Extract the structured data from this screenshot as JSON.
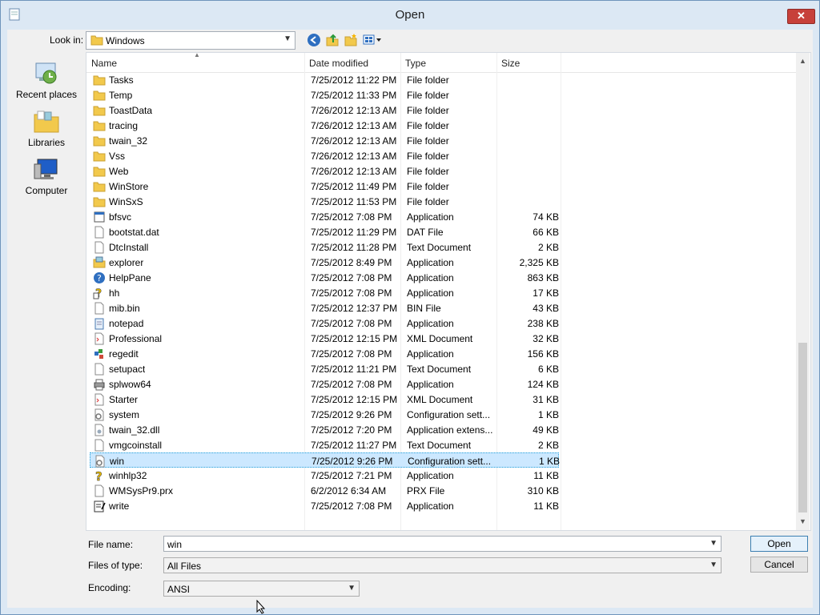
{
  "window": {
    "title": "Open",
    "close_glyph": "✕"
  },
  "toolbar": {
    "look_in_label": "Look in:",
    "look_in_value": "Windows"
  },
  "places": [
    {
      "label": "Recent places",
      "icon": "recent-places-icon"
    },
    {
      "label": "Libraries",
      "icon": "libraries-icon"
    },
    {
      "label": "Computer",
      "icon": "computer-icon"
    }
  ],
  "columns": {
    "name": "Name",
    "date": "Date modified",
    "type": "Type",
    "size": "Size"
  },
  "files": [
    {
      "name": "Tasks",
      "date": "7/25/2012 11:22 PM",
      "type": "File folder",
      "size": "",
      "icon": "folder"
    },
    {
      "name": "Temp",
      "date": "7/25/2012 11:33 PM",
      "type": "File folder",
      "size": "",
      "icon": "folder"
    },
    {
      "name": "ToastData",
      "date": "7/26/2012 12:13 AM",
      "type": "File folder",
      "size": "",
      "icon": "folder"
    },
    {
      "name": "tracing",
      "date": "7/26/2012 12:13 AM",
      "type": "File folder",
      "size": "",
      "icon": "folder"
    },
    {
      "name": "twain_32",
      "date": "7/26/2012 12:13 AM",
      "type": "File folder",
      "size": "",
      "icon": "folder"
    },
    {
      "name": "Vss",
      "date": "7/26/2012 12:13 AM",
      "type": "File folder",
      "size": "",
      "icon": "folder"
    },
    {
      "name": "Web",
      "date": "7/26/2012 12:13 AM",
      "type": "File folder",
      "size": "",
      "icon": "folder"
    },
    {
      "name": "WinStore",
      "date": "7/25/2012 11:49 PM",
      "type": "File folder",
      "size": "",
      "icon": "folder"
    },
    {
      "name": "WinSxS",
      "date": "7/25/2012 11:53 PM",
      "type": "File folder",
      "size": "",
      "icon": "folder"
    },
    {
      "name": "bfsvc",
      "date": "7/25/2012 7:08 PM",
      "type": "Application",
      "size": "74 KB",
      "icon": "app"
    },
    {
      "name": "bootstat.dat",
      "date": "7/25/2012 11:29 PM",
      "type": "DAT File",
      "size": "66 KB",
      "icon": "file"
    },
    {
      "name": "DtcInstall",
      "date": "7/25/2012 11:28 PM",
      "type": "Text Document",
      "size": "2 KB",
      "icon": "file"
    },
    {
      "name": "explorer",
      "date": "7/25/2012 8:49 PM",
      "type": "Application",
      "size": "2,325 KB",
      "icon": "explorer"
    },
    {
      "name": "HelpPane",
      "date": "7/25/2012 7:08 PM",
      "type": "Application",
      "size": "863 KB",
      "icon": "help"
    },
    {
      "name": "hh",
      "date": "7/25/2012 7:08 PM",
      "type": "Application",
      "size": "17 KB",
      "icon": "hh"
    },
    {
      "name": "mib.bin",
      "date": "7/25/2012 12:37 PM",
      "type": "BIN File",
      "size": "43 KB",
      "icon": "file"
    },
    {
      "name": "notepad",
      "date": "7/25/2012 7:08 PM",
      "type": "Application",
      "size": "238 KB",
      "icon": "notepad"
    },
    {
      "name": "Professional",
      "date": "7/25/2012 12:15 PM",
      "type": "XML Document",
      "size": "32 KB",
      "icon": "xml"
    },
    {
      "name": "regedit",
      "date": "7/25/2012 7:08 PM",
      "type": "Application",
      "size": "156 KB",
      "icon": "regedit"
    },
    {
      "name": "setupact",
      "date": "7/25/2012 11:21 PM",
      "type": "Text Document",
      "size": "6 KB",
      "icon": "file"
    },
    {
      "name": "splwow64",
      "date": "7/25/2012 7:08 PM",
      "type": "Application",
      "size": "124 KB",
      "icon": "printer"
    },
    {
      "name": "Starter",
      "date": "7/25/2012 12:15 PM",
      "type": "XML Document",
      "size": "31 KB",
      "icon": "xml"
    },
    {
      "name": "system",
      "date": "7/25/2012 9:26 PM",
      "type": "Configuration sett...",
      "size": "1 KB",
      "icon": "config"
    },
    {
      "name": "twain_32.dll",
      "date": "7/25/2012 7:20 PM",
      "type": "Application extens...",
      "size": "49 KB",
      "icon": "dll"
    },
    {
      "name": "vmgcoinstall",
      "date": "7/25/2012 11:27 PM",
      "type": "Text Document",
      "size": "2 KB",
      "icon": "file"
    },
    {
      "name": "win",
      "date": "7/25/2012 9:26 PM",
      "type": "Configuration sett...",
      "size": "1 KB",
      "icon": "config",
      "selected": true
    },
    {
      "name": "winhlp32",
      "date": "7/25/2012 7:21 PM",
      "type": "Application",
      "size": "11 KB",
      "icon": "winhlp"
    },
    {
      "name": "WMSysPr9.prx",
      "date": "6/2/2012 6:34 AM",
      "type": "PRX File",
      "size": "310 KB",
      "icon": "file"
    },
    {
      "name": "write",
      "date": "7/25/2012 7:08 PM",
      "type": "Application",
      "size": "11 KB",
      "icon": "write"
    }
  ],
  "form": {
    "file_name_label": "File name:",
    "file_name_value": "win",
    "files_of_type_label": "Files of type:",
    "files_of_type_value": "All Files",
    "encoding_label": "Encoding:",
    "encoding_value": "ANSI"
  },
  "buttons": {
    "open": "Open",
    "cancel": "Cancel"
  },
  "colors": {
    "selection": "#cce8ff",
    "window_frame": "#dce8f4",
    "close": "#c7403a"
  }
}
